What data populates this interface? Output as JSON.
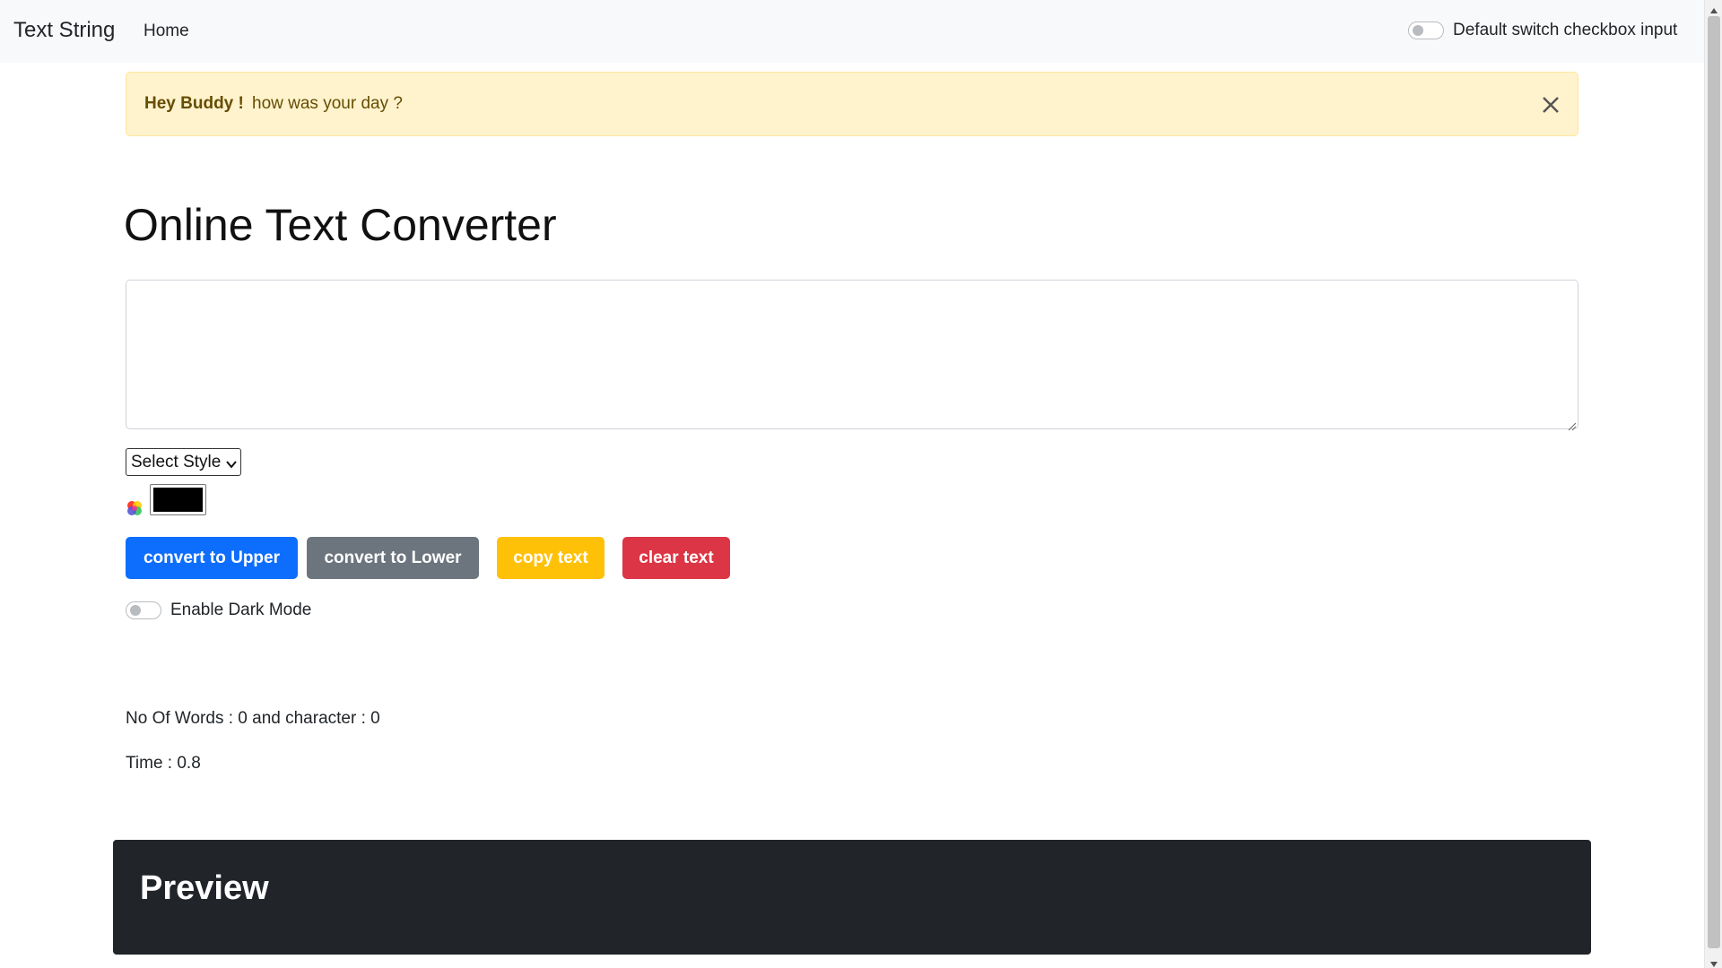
{
  "navbar": {
    "brand": "Text String",
    "home_link": "Home",
    "switch_label": "Default switch checkbox input"
  },
  "alert": {
    "strong": "Hey Buddy !",
    "message": "how was your day ?"
  },
  "main": {
    "title": "Online Text Converter",
    "textarea_value": "",
    "style_select": {
      "selected": "Select Style"
    },
    "color_value": "#000000",
    "buttons": {
      "upper": "convert to Upper",
      "lower": "convert to Lower",
      "copy": "copy text",
      "clear": "clear text"
    },
    "dark_mode_label": "Enable Dark Mode",
    "words_summary": "No Of Words : 0 and character : 0",
    "time_summary": "Time : 0.8"
  },
  "preview": {
    "title": "Preview"
  },
  "colors": {
    "primary": "#0d6efd",
    "secondary": "#6c757d",
    "warning": "#ffc107",
    "danger": "#dc3545",
    "alert_bg": "#fff3cd",
    "preview_bg": "#212529"
  }
}
